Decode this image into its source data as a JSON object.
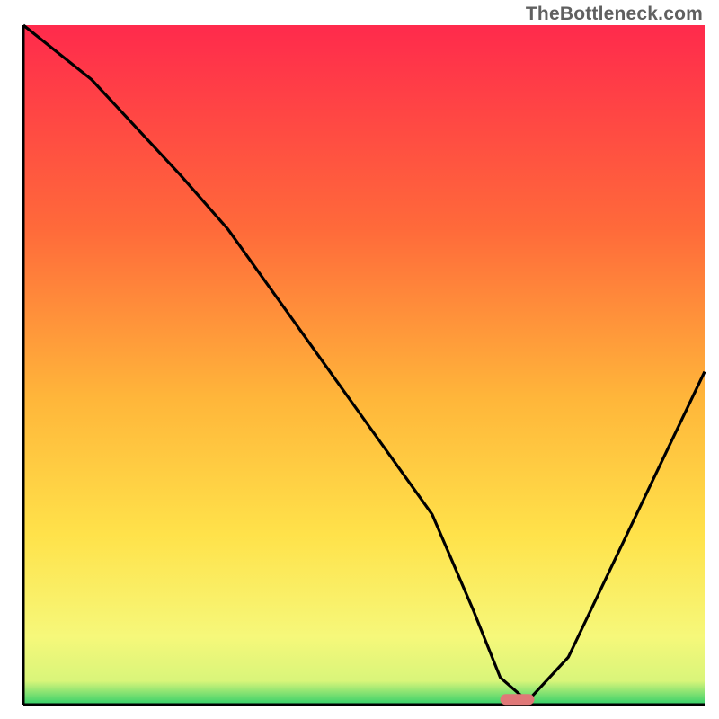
{
  "watermark": "TheBottleneck.com",
  "colors": {
    "grad_top": "#ff2a4c",
    "grad_mid1": "#ff7a3a",
    "grad_mid2": "#ffd23a",
    "grad_lower": "#f6f87a",
    "grad_bottom": "#33d06a",
    "axis": "#000000",
    "curve": "#000000",
    "marker": "#e07878"
  },
  "chart_data": {
    "type": "line",
    "title": "",
    "xlabel": "",
    "ylabel": "",
    "xlim": [
      0,
      100
    ],
    "ylim": [
      0,
      100
    ],
    "series": [
      {
        "name": "bottleneck-curve",
        "x": [
          0,
          10,
          23,
          30,
          40,
          50,
          60,
          66,
          70,
          74,
          80,
          90,
          100
        ],
        "y": [
          100,
          92,
          78,
          70,
          56,
          42,
          28,
          14,
          4,
          0.5,
          7,
          28,
          49
        ]
      }
    ],
    "annotations": [
      {
        "name": "optimal-marker",
        "x_start": 70,
        "x_end": 75,
        "y": 0.5
      }
    ],
    "gradient_stops": [
      {
        "offset": 0,
        "color": "#ff2a4c"
      },
      {
        "offset": 0.3,
        "color": "#ff6a3a"
      },
      {
        "offset": 0.55,
        "color": "#ffb63a"
      },
      {
        "offset": 0.75,
        "color": "#ffe24a"
      },
      {
        "offset": 0.9,
        "color": "#f6f87a"
      },
      {
        "offset": 0.965,
        "color": "#d9f57a"
      },
      {
        "offset": 1.0,
        "color": "#33d06a"
      }
    ]
  }
}
